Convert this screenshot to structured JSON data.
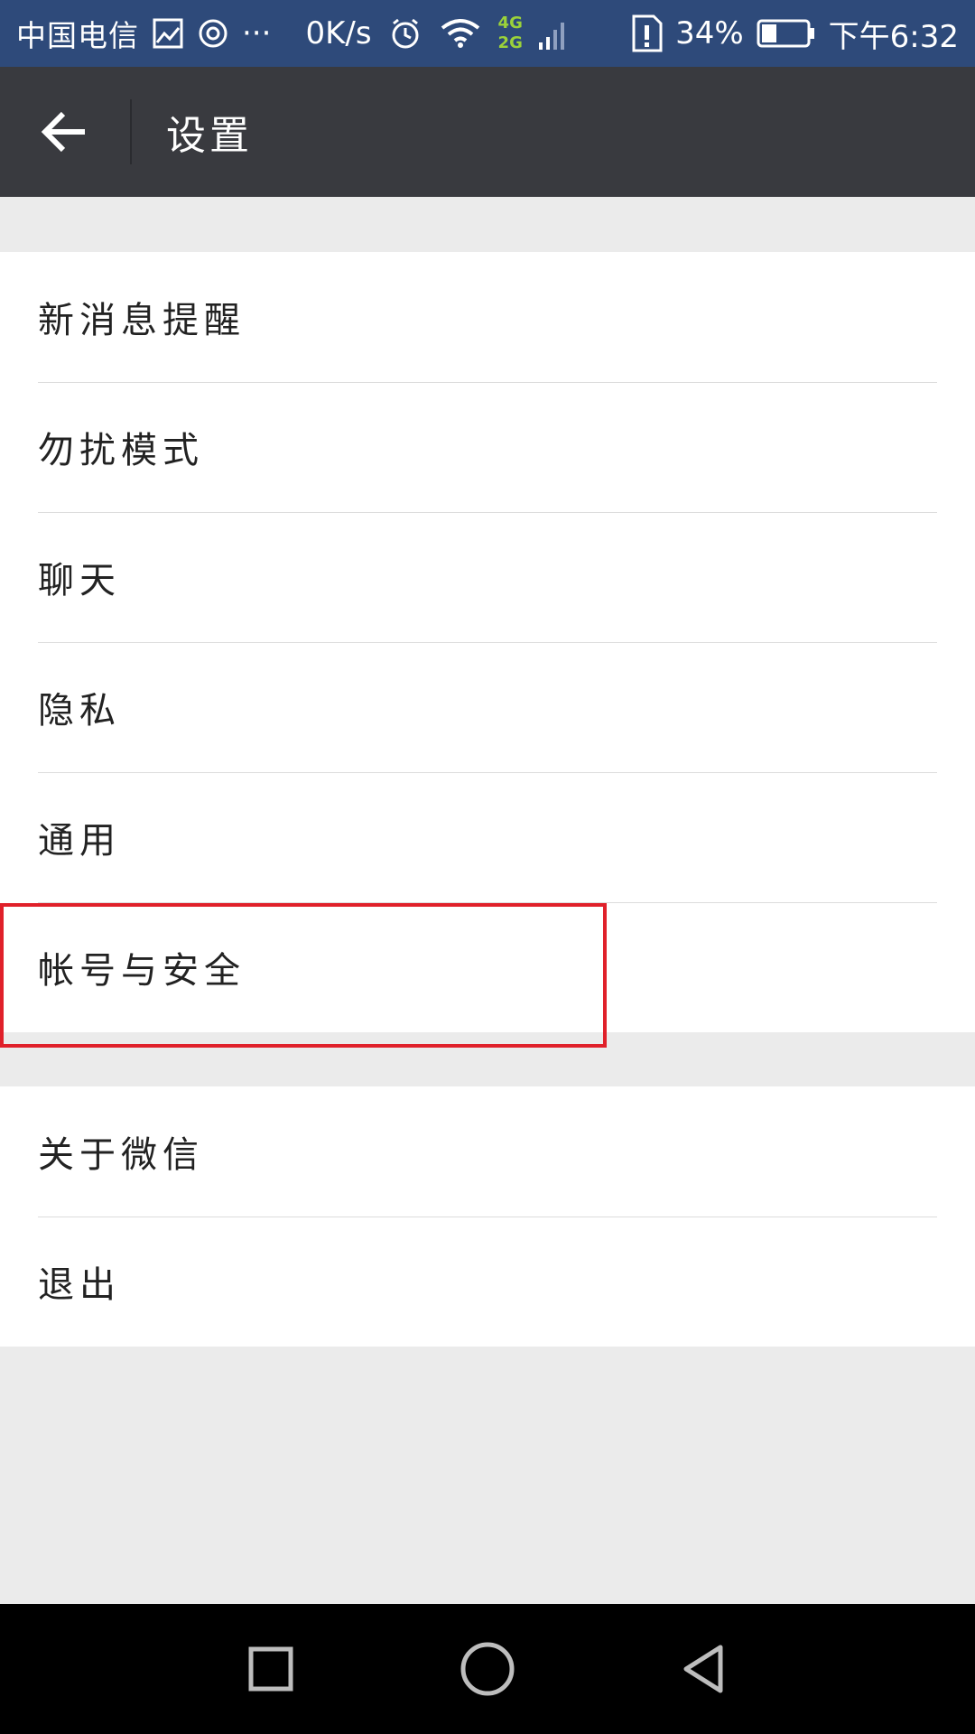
{
  "status_bar": {
    "carrier": "中国电信",
    "more": "···",
    "net_speed": "0K/s",
    "net_type_top": "4G",
    "net_type_bottom": "2G",
    "battery_percent": "34%",
    "time": "下午6:32",
    "battery_level": 0.34
  },
  "title_bar": {
    "title": "设置"
  },
  "settings_group_1": {
    "items": [
      {
        "label": "新消息提醒"
      },
      {
        "label": "勿扰模式"
      },
      {
        "label": "聊天"
      },
      {
        "label": "隐私"
      },
      {
        "label": "通用"
      },
      {
        "label": "帐号与安全"
      }
    ]
  },
  "settings_group_2": {
    "items": [
      {
        "label": "关于微信"
      },
      {
        "label": "退出"
      }
    ]
  },
  "colors": {
    "status_bar_bg": "#2e4a7a",
    "title_bar_bg": "#393a3f",
    "highlight": "#e0202a",
    "page_bg": "#ebebeb"
  },
  "icons": {
    "status": [
      "image-icon",
      "circle-icon",
      "alarm-icon",
      "wifi-icon",
      "signal-icon",
      "sim-alert-icon",
      "battery-icon"
    ],
    "title": [
      "back-arrow-icon"
    ],
    "nav": [
      "recents-square-icon",
      "home-circle-icon",
      "back-triangle-icon"
    ]
  }
}
